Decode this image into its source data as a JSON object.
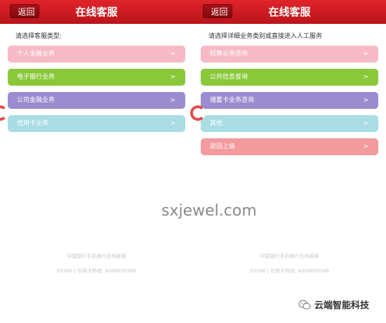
{
  "colors": {
    "header": "#d31c22",
    "pink": "#f7b9c6",
    "green": "#8ac83a",
    "purple": "#9b8ccf",
    "cyan": "#a9dde3",
    "salmon": "#f29a9d"
  },
  "left": {
    "back_label": "返回",
    "title": "在线客服",
    "hint": "请选择客服类型:",
    "items": [
      {
        "label": "个人金融业务",
        "color": "#f7b9c6"
      },
      {
        "label": "电子银行业务",
        "color": "#8ac83a"
      },
      {
        "label": "公司金融业务",
        "color": "#9b8ccf"
      },
      {
        "label": "信用卡业务",
        "color": "#a9dde3"
      }
    ],
    "footer_line1": "中国银行手机银行在线客服",
    "footer_line2": "95566 | 信用卡热线: 4006695566"
  },
  "right": {
    "back_label": "返回",
    "title": "在线客服",
    "hint": "请选择详细业务类别或直接进入人工服务",
    "items": [
      {
        "label": "结算业务咨询",
        "color": "#f7b9c6"
      },
      {
        "label": "公共信息查询",
        "color": "#8ac83a"
      },
      {
        "label": "储蓄卡业务咨询",
        "color": "#9b8ccf"
      },
      {
        "label": "其他",
        "color": "#a9dde3"
      },
      {
        "label": "返回上级",
        "color": "#f29a9d"
      }
    ],
    "footer_line1": "中国银行手机银行在线客服",
    "footer_line2": "95566 | 信用卡热线: 4006695566"
  },
  "chevron": ">",
  "watermark": "sxjewel.com",
  "brand": "云端智能科技"
}
